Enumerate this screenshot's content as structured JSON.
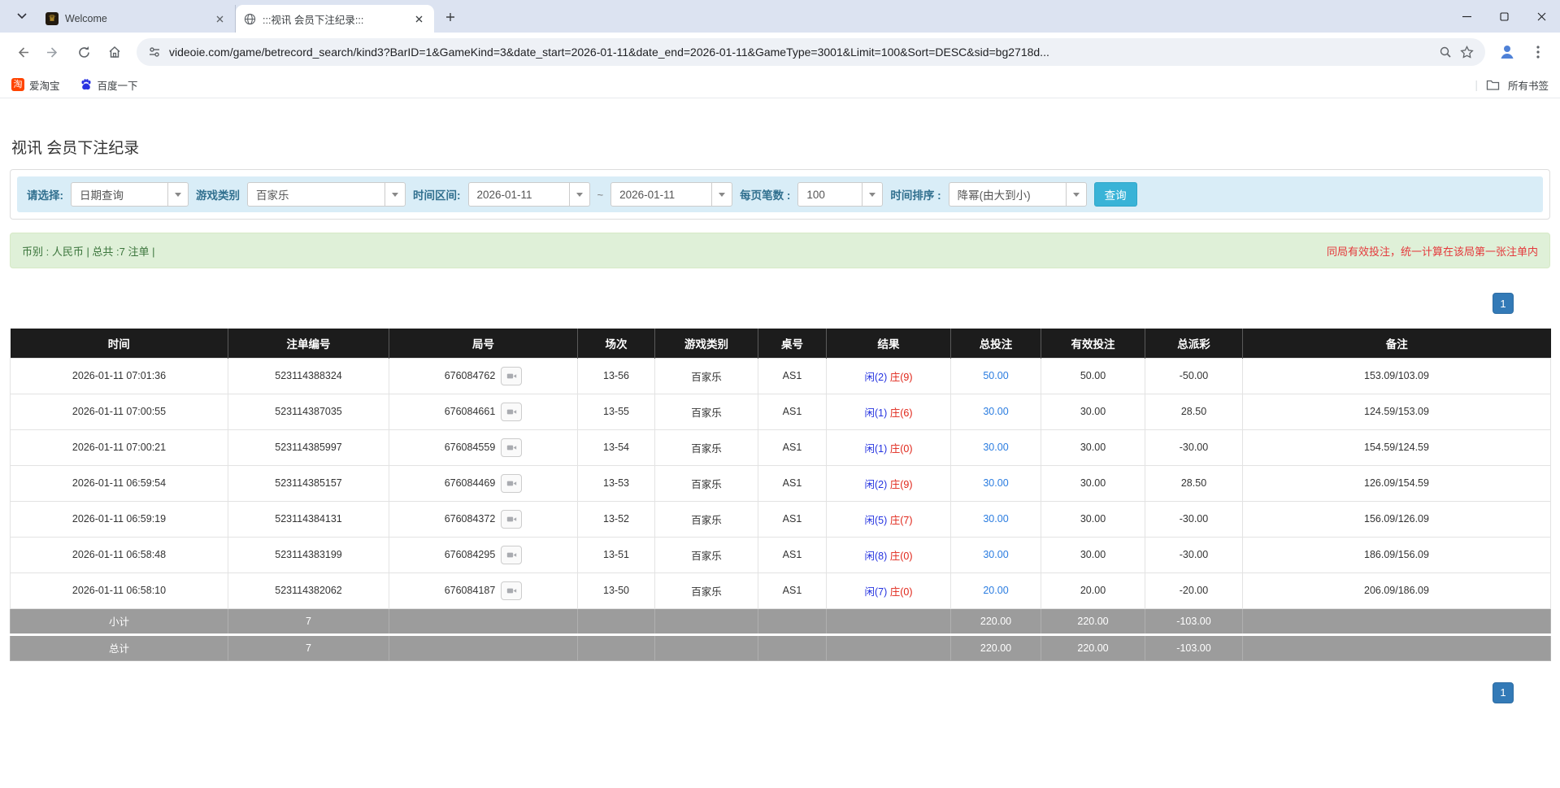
{
  "browser": {
    "tabs": [
      {
        "title": "Welcome"
      },
      {
        "title": ":::视讯 会员下注纪录:::"
      }
    ],
    "url": "videoie.com/game/betrecord_search/kind3?BarID=1&GameKind=3&date_start=2026-01-11&date_end=2026-01-11&GameType=3001&Limit=100&Sort=DESC&sid=bg2718d...",
    "bookmarks": [
      {
        "label": "爱淘宝"
      },
      {
        "label": "百度一下"
      }
    ],
    "bookmarks_right": "所有书签"
  },
  "page": {
    "title": "视讯 会员下注纪录",
    "filters": {
      "select_label": "请选择:",
      "select_value": "日期查询",
      "game_label": "游戏类别",
      "game_value": "百家乐",
      "range_label": "时间区间:",
      "date_start": "2026-01-11",
      "range_separator": "~",
      "date_end": "2026-01-11",
      "per_page_label": "每页笔数 :",
      "per_page_value": "100",
      "sort_label": "时间排序 :",
      "sort_value": "降幂(由大到小)",
      "search_button": "查询"
    },
    "summary": {
      "left": "币别 : 人民币 | 总共 :7 注单 |",
      "right": "同局有效投注，统一计算在该局第一张注单内"
    },
    "pagination": "1",
    "table": {
      "headers": [
        "时间",
        "注单编号",
        "局号",
        "场次",
        "游戏类别",
        "桌号",
        "结果",
        "总投注",
        "有效投注",
        "总派彩",
        "备注"
      ],
      "rows": [
        {
          "time": "2026-01-11 07:01:36",
          "bet_no": "523114388324",
          "round_no": "676084762",
          "session": "13-56",
          "game": "百家乐",
          "table_no": "AS1",
          "result_player": "闲(2)",
          "result_banker": "庄(9)",
          "total_bet": "50.00",
          "valid_bet": "50.00",
          "payout": "-50.00",
          "payout_neg": true,
          "note": "153.09/103.09"
        },
        {
          "time": "2026-01-11 07:00:55",
          "bet_no": "523114387035",
          "round_no": "676084661",
          "session": "13-55",
          "game": "百家乐",
          "table_no": "AS1",
          "result_player": "闲(1)",
          "result_banker": "庄(6)",
          "total_bet": "30.00",
          "valid_bet": "30.00",
          "payout": "28.50",
          "payout_neg": false,
          "note": "124.59/153.09"
        },
        {
          "time": "2026-01-11 07:00:21",
          "bet_no": "523114385997",
          "round_no": "676084559",
          "session": "13-54",
          "game": "百家乐",
          "table_no": "AS1",
          "result_player": "闲(1)",
          "result_banker": "庄(0)",
          "total_bet": "30.00",
          "valid_bet": "30.00",
          "payout": "-30.00",
          "payout_neg": true,
          "note": "154.59/124.59"
        },
        {
          "time": "2026-01-11 06:59:54",
          "bet_no": "523114385157",
          "round_no": "676084469",
          "session": "13-53",
          "game": "百家乐",
          "table_no": "AS1",
          "result_player": "闲(2)",
          "result_banker": "庄(9)",
          "total_bet": "30.00",
          "valid_bet": "30.00",
          "payout": "28.50",
          "payout_neg": false,
          "note": "126.09/154.59"
        },
        {
          "time": "2026-01-11 06:59:19",
          "bet_no": "523114384131",
          "round_no": "676084372",
          "session": "13-52",
          "game": "百家乐",
          "table_no": "AS1",
          "result_player": "闲(5)",
          "result_banker": "庄(7)",
          "total_bet": "30.00",
          "valid_bet": "30.00",
          "payout": "-30.00",
          "payout_neg": true,
          "note": "156.09/126.09"
        },
        {
          "time": "2026-01-11 06:58:48",
          "bet_no": "523114383199",
          "round_no": "676084295",
          "session": "13-51",
          "game": "百家乐",
          "table_no": "AS1",
          "result_player": "闲(8)",
          "result_banker": "庄(0)",
          "total_bet": "30.00",
          "valid_bet": "30.00",
          "payout": "-30.00",
          "payout_neg": true,
          "note": "186.09/156.09"
        },
        {
          "time": "2026-01-11 06:58:10",
          "bet_no": "523114382062",
          "round_no": "676084187",
          "session": "13-50",
          "game": "百家乐",
          "table_no": "AS1",
          "result_player": "闲(7)",
          "result_banker": "庄(0)",
          "total_bet": "20.00",
          "valid_bet": "20.00",
          "payout": "-20.00",
          "payout_neg": true,
          "note": "206.09/186.09"
        }
      ],
      "subtotal": {
        "label": "小计",
        "count": "7",
        "total_bet": "220.00",
        "valid_bet": "220.00",
        "payout": "-103.00"
      },
      "total": {
        "label": "总计",
        "count": "7",
        "total_bet": "220.00",
        "valid_bet": "220.00",
        "payout": "-103.00"
      }
    }
  }
}
